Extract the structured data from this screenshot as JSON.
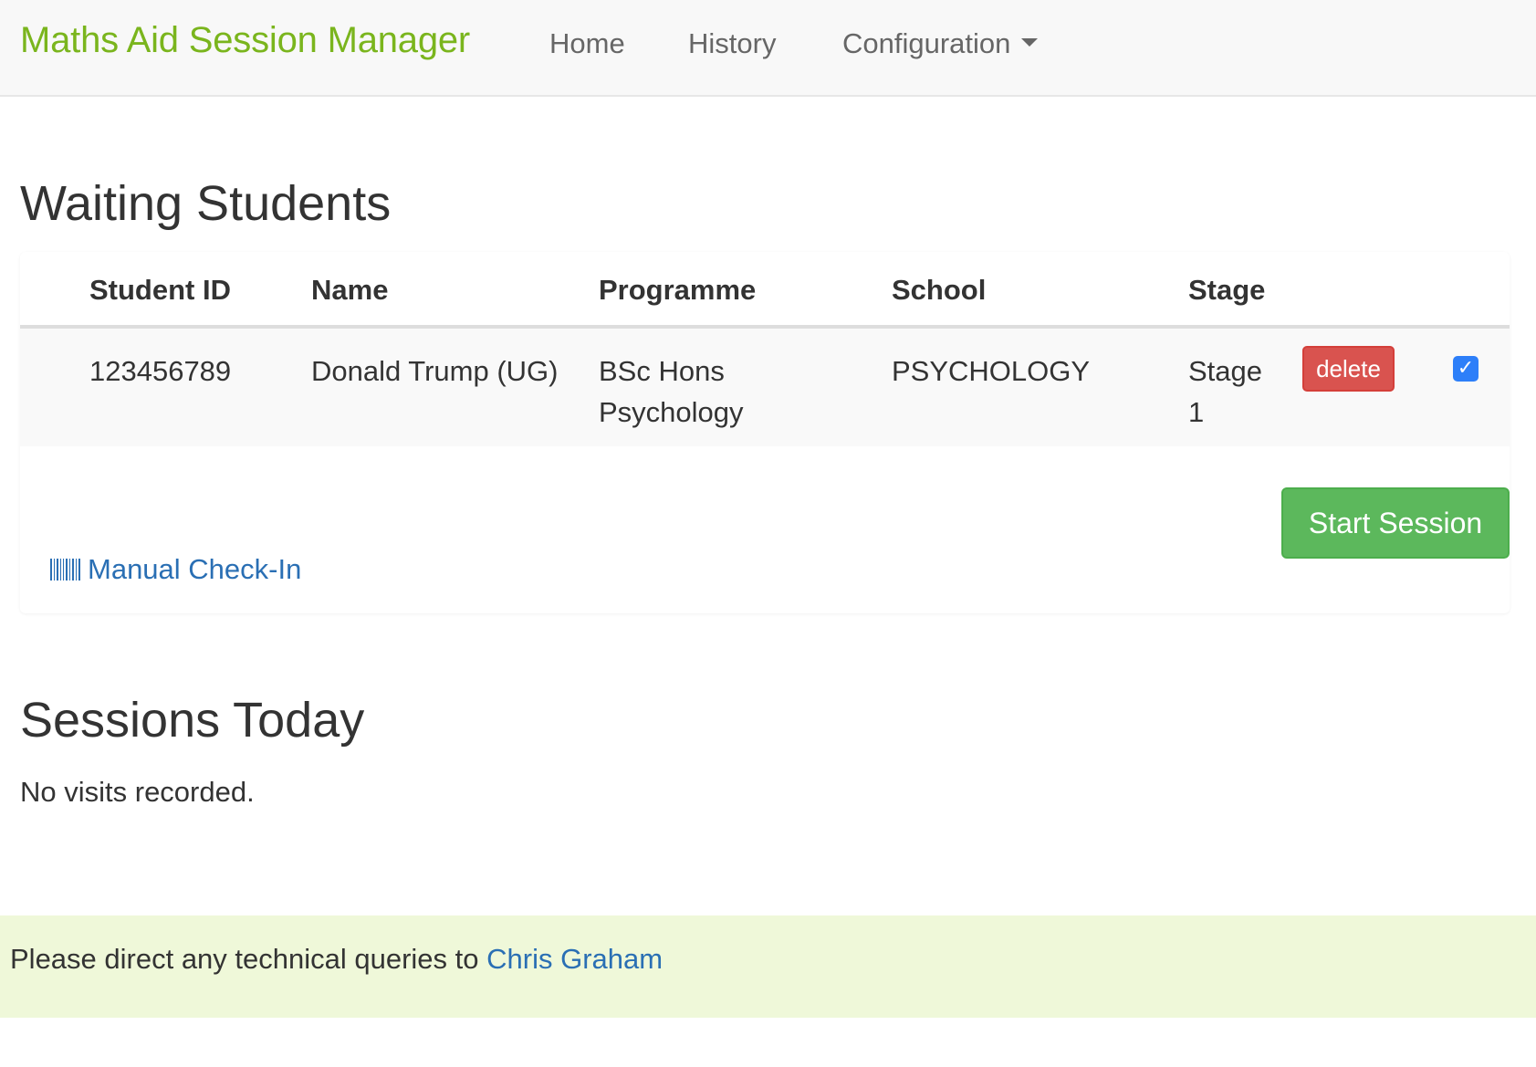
{
  "app": {
    "title": "Maths Aid Session Manager",
    "brand_color": "#7ab51d"
  },
  "nav": {
    "items": [
      {
        "label": "Home"
      },
      {
        "label": "History"
      },
      {
        "label": "Configuration",
        "icon": "chevron-down-icon"
      }
    ]
  },
  "waiting": {
    "heading": "Waiting Students",
    "columns": [
      "Student ID",
      "Name",
      "Programme",
      "School",
      "Stage"
    ],
    "rows": [
      {
        "student_id": "123456789",
        "name": "Donald Trump (UG)",
        "programme": "BSc Hons Psychology",
        "school": "PSYCHOLOGY",
        "stage": "Stage 1",
        "delete_label": "delete",
        "selected": true
      }
    ],
    "start_label": "Start Session",
    "manual_checkin_label": "Manual Check-In",
    "manual_checkin_icon": "barcode-icon"
  },
  "sessions": {
    "heading": "Sessions Today",
    "empty_text": "No visits recorded."
  },
  "footer": {
    "text": "Please direct any technical queries to ",
    "contact_name": "Chris Graham"
  },
  "colors": {
    "delete": "#d9534f",
    "start": "#5cb85c",
    "link": "#2a6fb4",
    "footer_bg": "#eff8d9",
    "checkbox": "#2d7ff9"
  }
}
